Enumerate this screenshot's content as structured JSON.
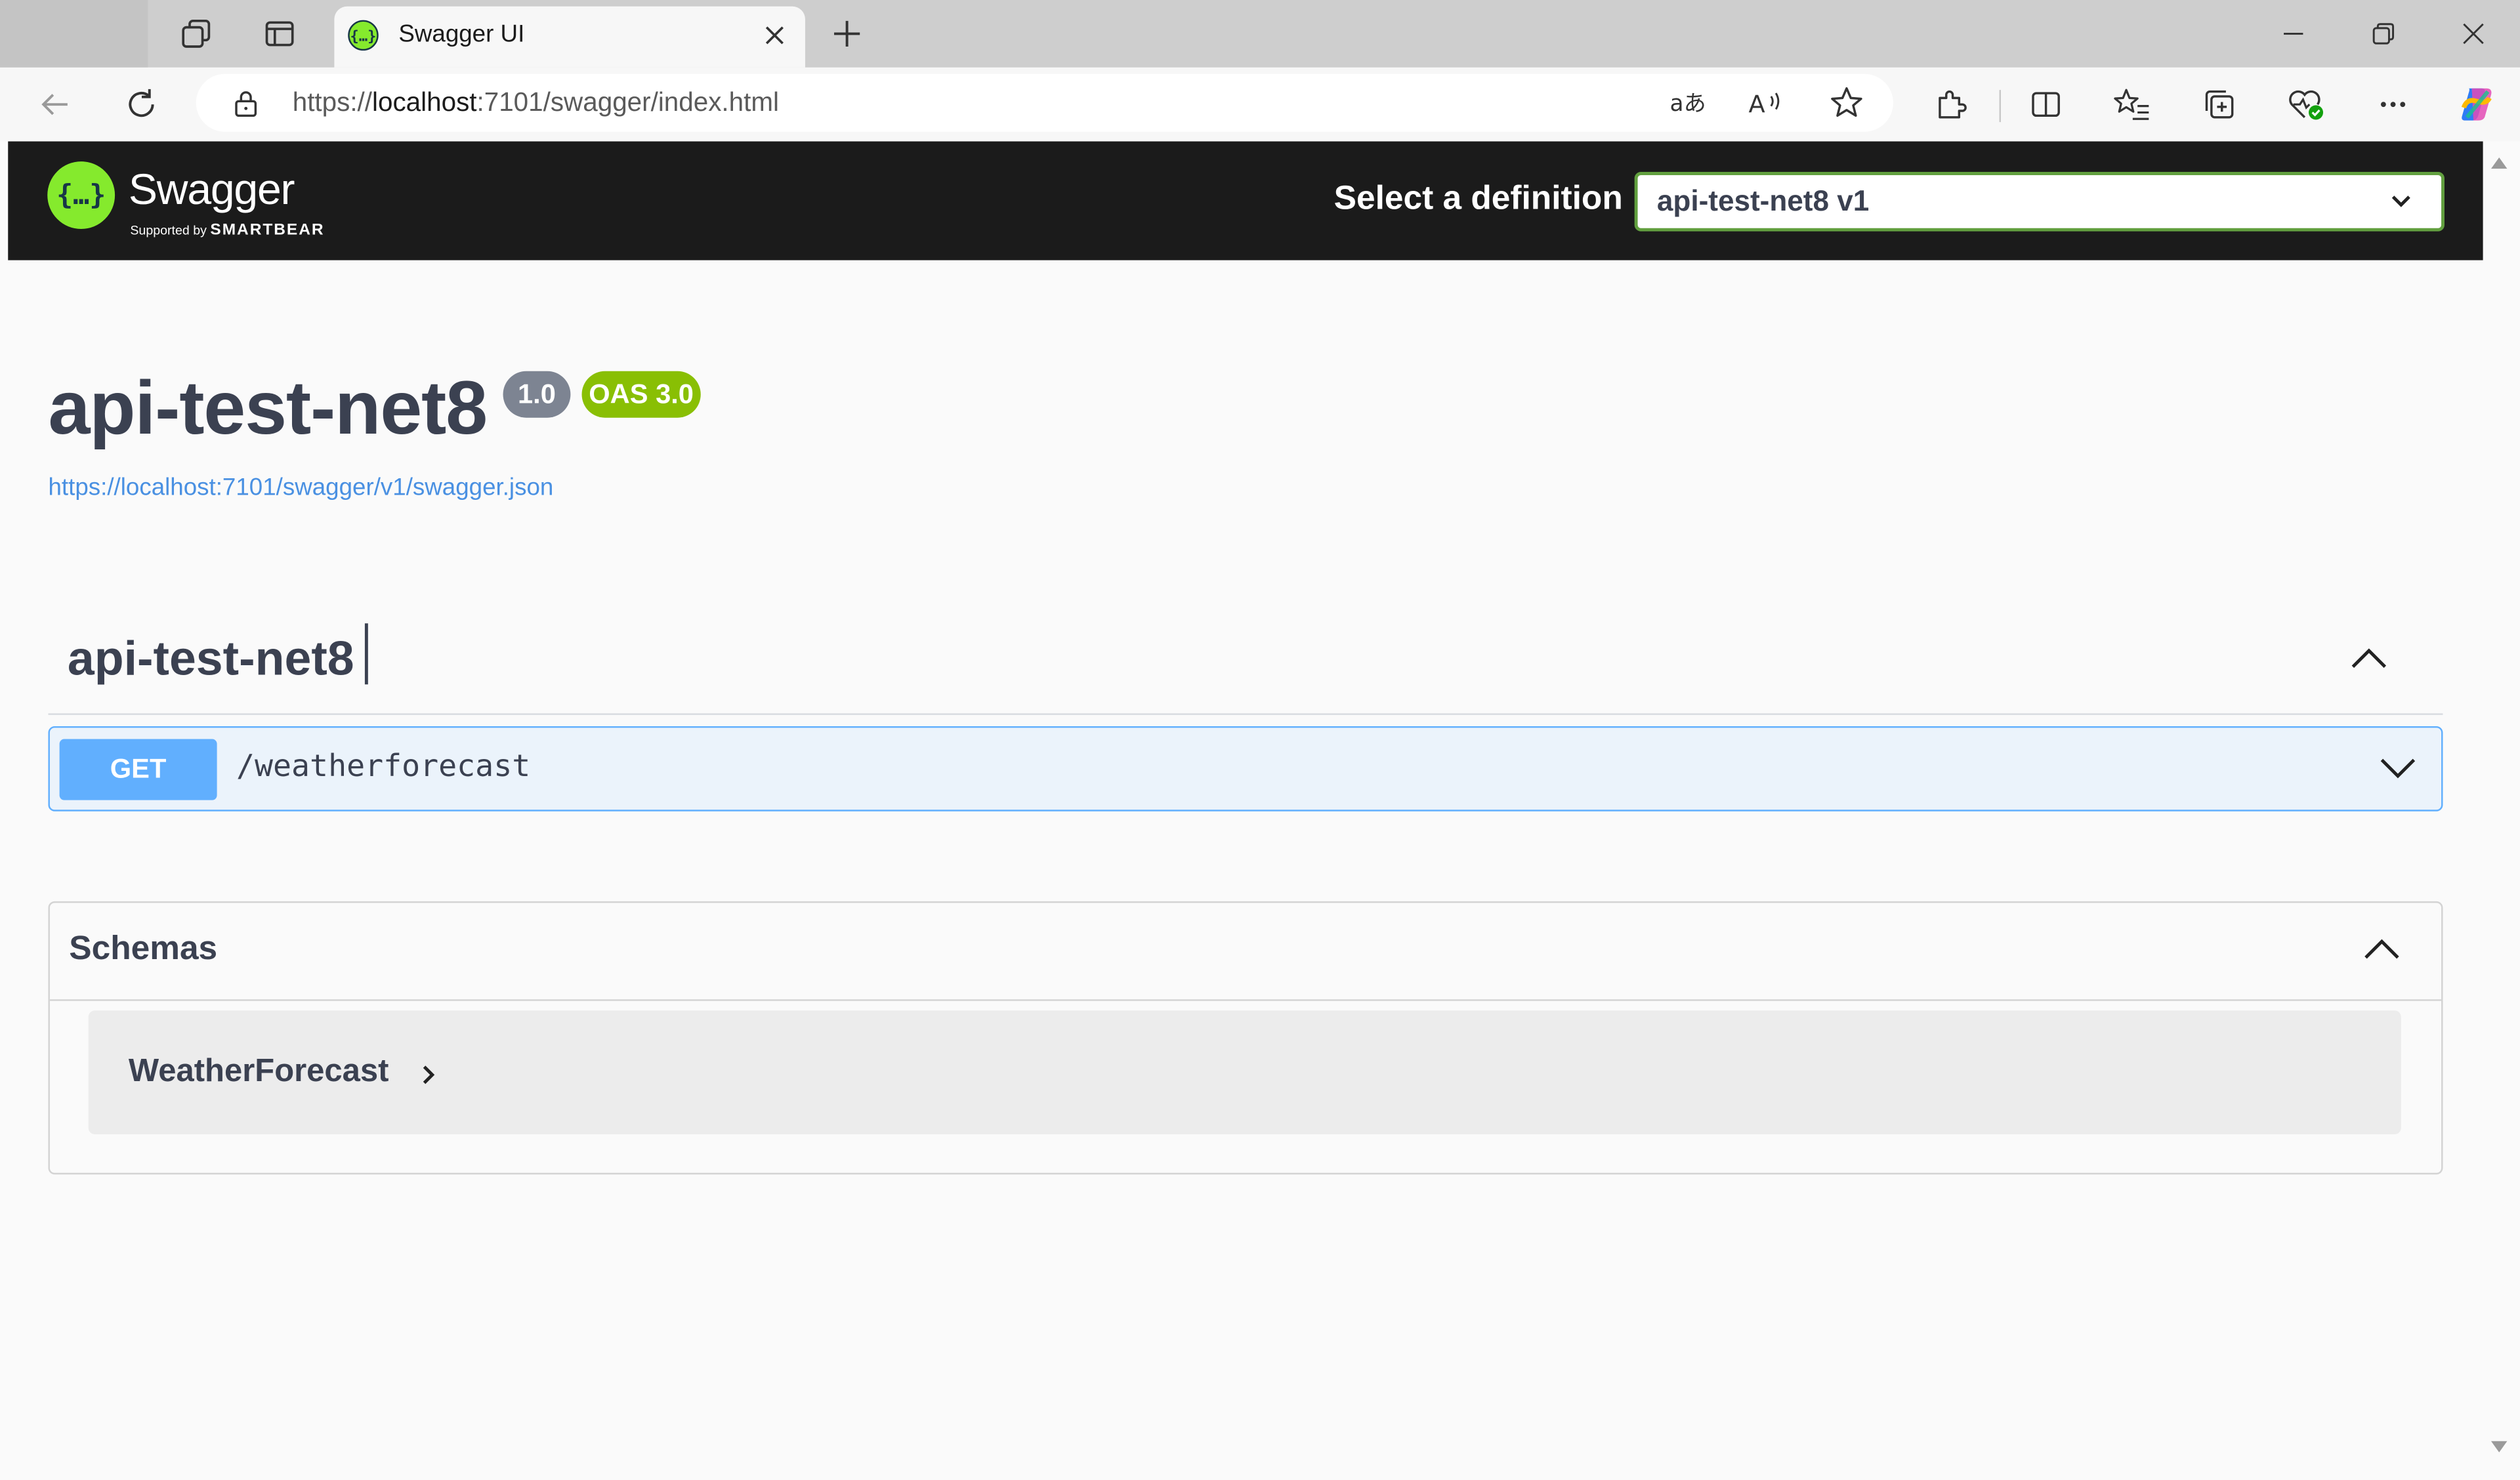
{
  "browser": {
    "tab_title": "Swagger UI",
    "address_prefix": "https://",
    "address_host": "localhost",
    "address_rest": ":7101/swagger/index.html"
  },
  "swagger": {
    "brand": "Swagger",
    "supported_by": "Supported by",
    "smartbear": "SMARTBEAR",
    "select_label": "Select a definition",
    "selected_definition": "api-test-net8 v1"
  },
  "info": {
    "title": "api-test-net8",
    "version_badge": "1.0",
    "oas_badge": "OAS 3.0",
    "spec_url": "https://localhost:7101/swagger/v1/swagger.json"
  },
  "tag": {
    "name": "api-test-net8"
  },
  "operations": [
    {
      "method": "GET",
      "path": "/weatherforecast"
    }
  ],
  "schemas": {
    "title": "Schemas",
    "models": [
      "WeatherForecast"
    ]
  },
  "colors": {
    "swagger_green": "#85ea2d",
    "get_blue": "#61affe",
    "topbar": "#1b1b1b",
    "version_badge": "#7d8492",
    "oas_badge": "#89bf04"
  },
  "icons": {
    "favicon": "swagger-logo-icon",
    "back": "arrow-left-icon",
    "refresh": "refresh-icon",
    "lock": "lock-icon",
    "expand_op": "chevron-down-icon",
    "collapse_tag": "chevron-up-icon",
    "model_expand": "chevron-right-icon"
  }
}
